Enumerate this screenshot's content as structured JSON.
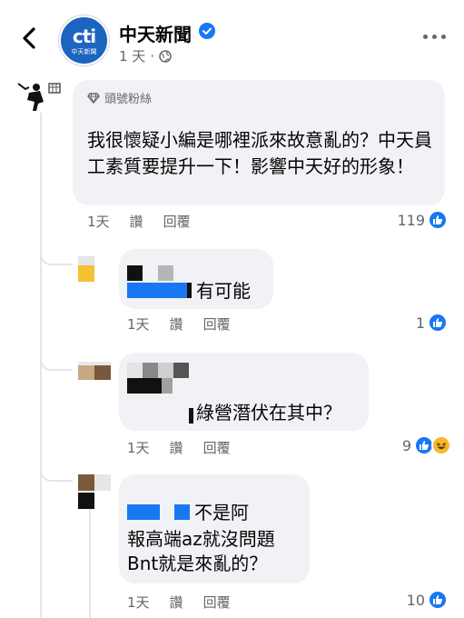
{
  "header": {
    "page_name": "中天新聞",
    "time": "1 天",
    "logo_text": "cti",
    "logo_sub": "中天新聞"
  },
  "comments": [
    {
      "badge": "頭號粉絲",
      "text": "我很懷疑小編是哪裡派來故意亂的？中天員工素質要提升一下！影響中天好的形象！",
      "time": "1天",
      "like_action": "讚",
      "reply_action": "回覆",
      "reaction_count": "119"
    },
    {
      "text": "有可能",
      "time": "1天",
      "like_action": "讚",
      "reply_action": "回覆",
      "reaction_count": "1"
    },
    {
      "text": "綠營潛伏在其中？",
      "time": "1天",
      "like_action": "讚",
      "reply_action": "回覆",
      "reaction_count": "9"
    },
    {
      "lines": [
        "不是阿",
        "報高端az就沒問題",
        "Bnt就是來亂的？"
      ],
      "time": "1天",
      "like_action": "讚",
      "reply_action": "回覆",
      "reaction_count": "10"
    }
  ],
  "icons": {
    "back": "chevron-left-icon",
    "verified": "verified-badge-icon",
    "globe": "globe-icon",
    "more": "more-horizontal-icon",
    "like": "like-reaction-icon",
    "haha": "haha-reaction-icon",
    "fan": "top-fan-diamond-icon"
  },
  "colors": {
    "brand_blue": "#1877f2",
    "bubble": "#f0f2f5",
    "secondary_text": "#65676b"
  }
}
